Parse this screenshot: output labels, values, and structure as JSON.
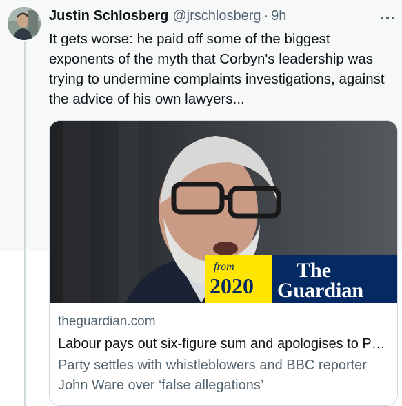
{
  "tweet": {
    "author_name": "Justin Schlosberg",
    "handle": "@jrschlosberg",
    "separator": "·",
    "time": "9h",
    "more_icon": "more-horizontal-icon",
    "text": "It gets worse: he paid off some of the biggest exponents of the myth that Corbyn's leadership was trying to undermine complaints investigations, against the advice of his own lawyers..."
  },
  "card": {
    "badge": {
      "from": "from",
      "year": "2020",
      "logo_line1": "The",
      "logo_line2": "Guardian"
    },
    "domain": "theguardian.com",
    "headline": "Labour pays out six-figure sum and apologises to Panorama whistleblowers",
    "description": "Party settles with whistleblowers and BBC reporter John Ware over ‘false allegations’"
  },
  "colors": {
    "guardian_blue": "#052962",
    "badge_yellow": "#ffe500",
    "secondary_text": "#536471",
    "hover_bg": "#f7f9f9"
  }
}
